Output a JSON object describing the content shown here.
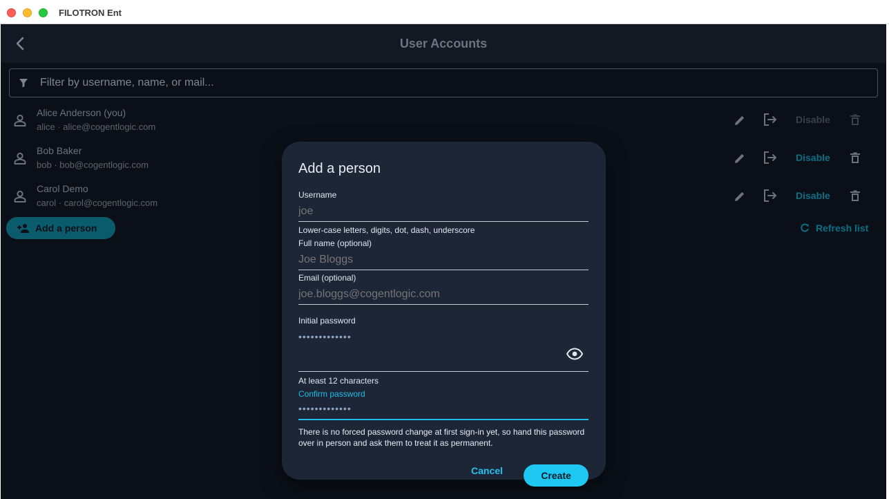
{
  "window": {
    "title": "FILOTRON Ent"
  },
  "appbar": {
    "title": "User Accounts"
  },
  "filter": {
    "placeholder": "Filter by username, name, or mail..."
  },
  "users": [
    {
      "name": "Alice Anderson (you)",
      "sub": "alice · alice@cogentlogic.com",
      "disable_label": "Disable",
      "disable_enabled": false
    },
    {
      "name": "Bob Baker",
      "sub": "bob · bob@cogentlogic.com",
      "disable_label": "Disable",
      "disable_enabled": true
    },
    {
      "name": "Carol Demo",
      "sub": "carol · carol@cogentlogic.com",
      "disable_label": "Disable",
      "disable_enabled": true
    }
  ],
  "actions": {
    "add_person_label": "Add a person",
    "refresh_label": "Refresh list"
  },
  "dialog": {
    "title": "Add a person",
    "username": {
      "label": "Username",
      "placeholder": "joe",
      "helper": "Lower-case letters, digits, dot, dash, underscore"
    },
    "fullname": {
      "label": "Full name (optional)",
      "placeholder": "Joe Bloggs"
    },
    "email": {
      "label": "Email (optional)",
      "placeholder": "joe.bloggs@cogentlogic.com"
    },
    "password": {
      "label": "Initial password",
      "value": "•••••••••••••",
      "helper": "At least 12 characters"
    },
    "confirm": {
      "label": "Confirm password",
      "value": "•••••••••••••"
    },
    "note": "There is no forced password change at first sign-in yet, so hand this password over in person and ask them to treat it as permanent.",
    "cancel_label": "Cancel",
    "create_label": "Create"
  },
  "colors": {
    "accent": "#1ec8f2",
    "background": "#0b1018",
    "dialog": "#1d2637"
  }
}
